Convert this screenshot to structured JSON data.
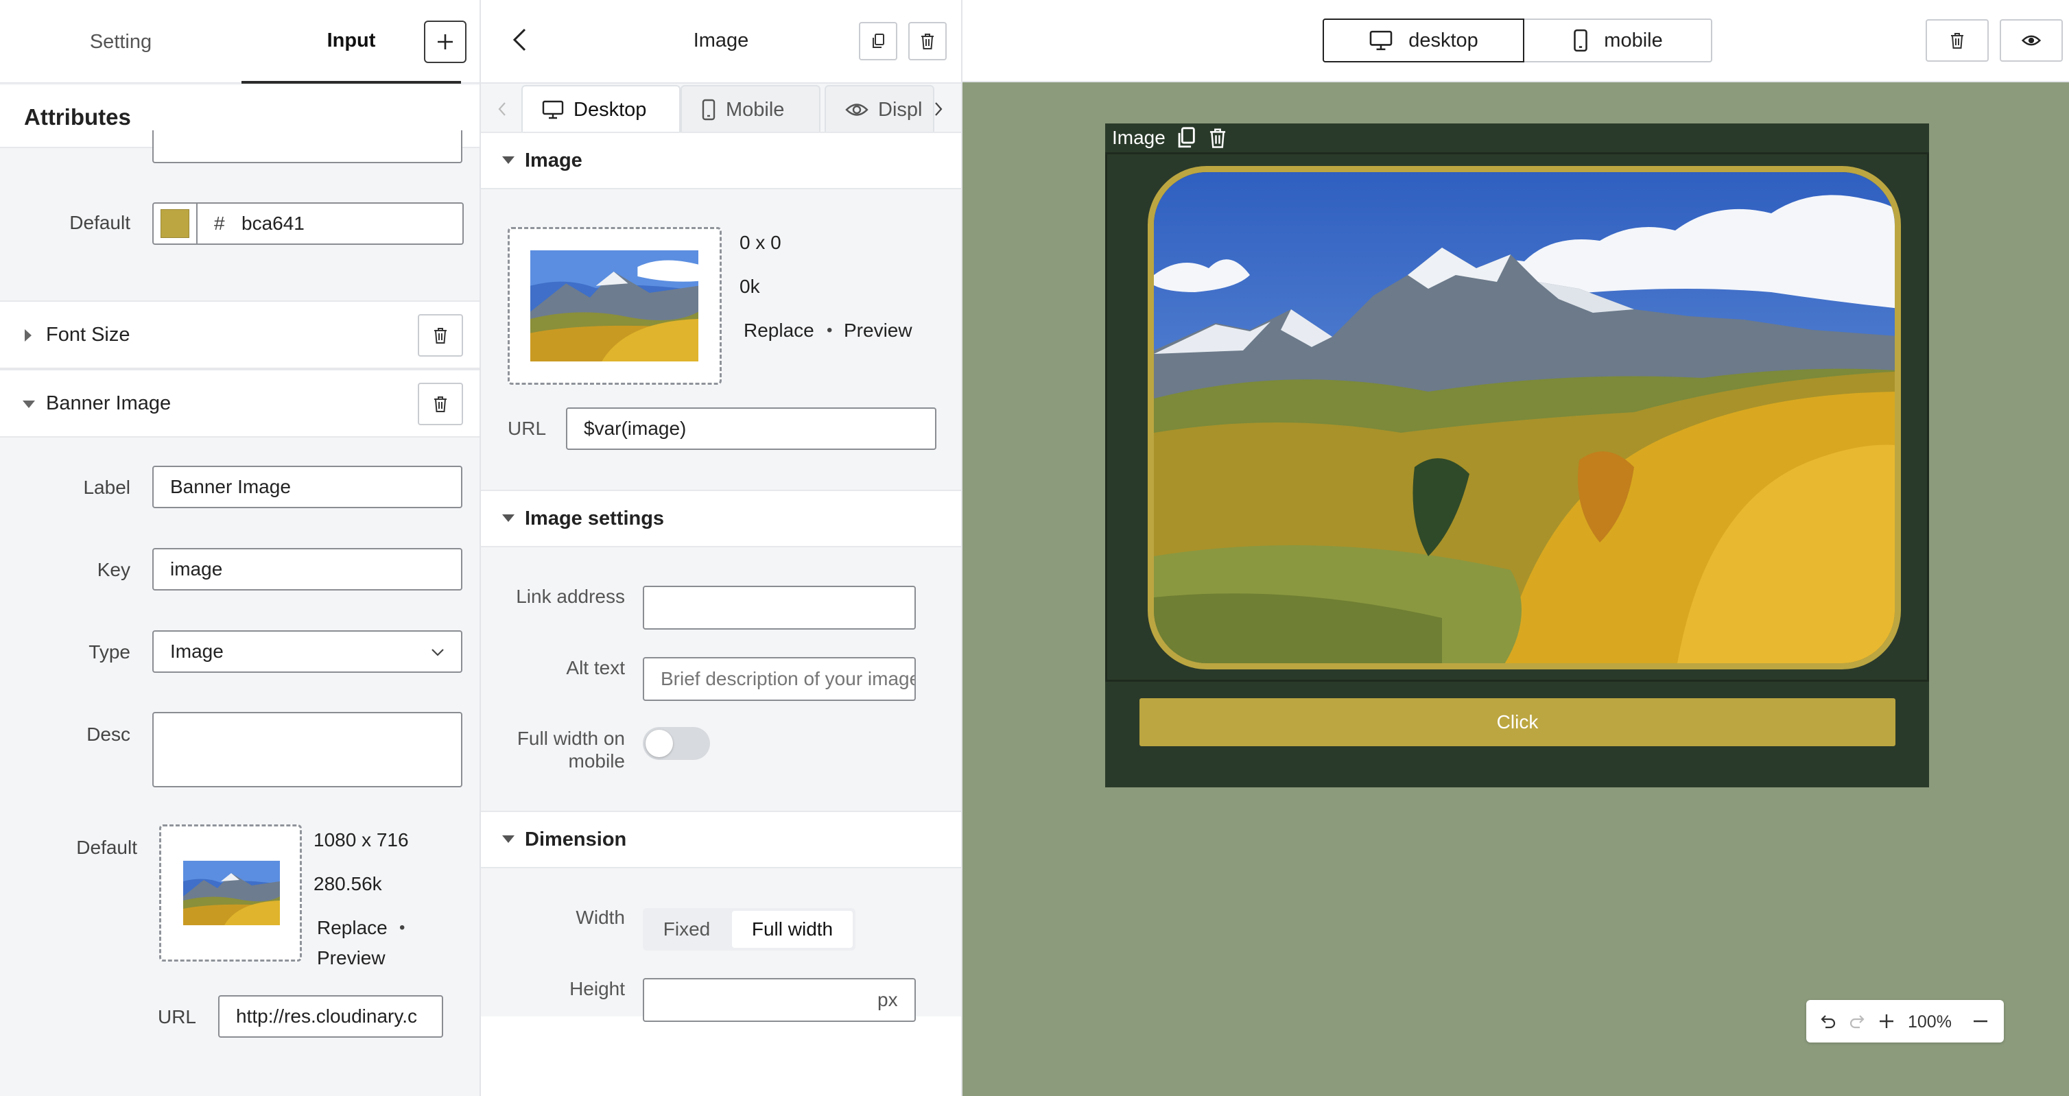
{
  "left_panel": {
    "tabs": [
      {
        "label": "Setting"
      },
      {
        "label": "Input"
      }
    ],
    "attributes_title": "Attributes",
    "default_color": {
      "label": "Default",
      "hash": "#",
      "value": "bca641",
      "swatch": "#bca641"
    },
    "font_size": {
      "title": "Font Size"
    },
    "banner_image": {
      "title": "Banner Image",
      "label": {
        "label": "Label",
        "value": "Banner Image"
      },
      "key": {
        "label": "Key",
        "value": "image"
      },
      "type": {
        "label": "Type",
        "value": "Image"
      },
      "desc": {
        "label": "Desc",
        "value": ""
      },
      "default": {
        "label": "Default",
        "dimensions": "1080 x 716",
        "size": "280.56k",
        "replace": "Replace",
        "separator": "•",
        "preview": "Preview"
      },
      "url": {
        "label": "URL",
        "value": "http://res.cloudinary.c"
      }
    }
  },
  "middle_panel": {
    "title": "Image",
    "device_tabs": [
      {
        "label": "Desktop"
      },
      {
        "label": "Mobile"
      },
      {
        "label": "Displ"
      }
    ],
    "image_section": {
      "title": "Image",
      "dimensions": "0 x 0",
      "size": "0k",
      "replace": "Replace",
      "separator": "•",
      "preview": "Preview",
      "url_label": "URL",
      "url_value": "$var(image)"
    },
    "image_settings": {
      "title": "Image settings",
      "link_label": "Link address",
      "link_value": "",
      "alt_label": "Alt text",
      "alt_placeholder": "Brief description of your image",
      "full_width_label": "Full width on mobile",
      "full_width_on": false
    },
    "dimension": {
      "title": "Dimension",
      "width_label": "Width",
      "width_options": [
        "Fixed",
        "Full width"
      ],
      "width_selected": "Full width",
      "height_label": "Height",
      "height_unit": "px"
    }
  },
  "canvas": {
    "view_modes": [
      {
        "label": "desktop"
      },
      {
        "label": "mobile"
      }
    ],
    "active_view": "desktop",
    "block_label": "Image",
    "button_label": "Click",
    "zoom": "100%",
    "colors": {
      "background": "#8c9b7c",
      "block": "#2a3a2a",
      "accent": "#bca641"
    }
  }
}
